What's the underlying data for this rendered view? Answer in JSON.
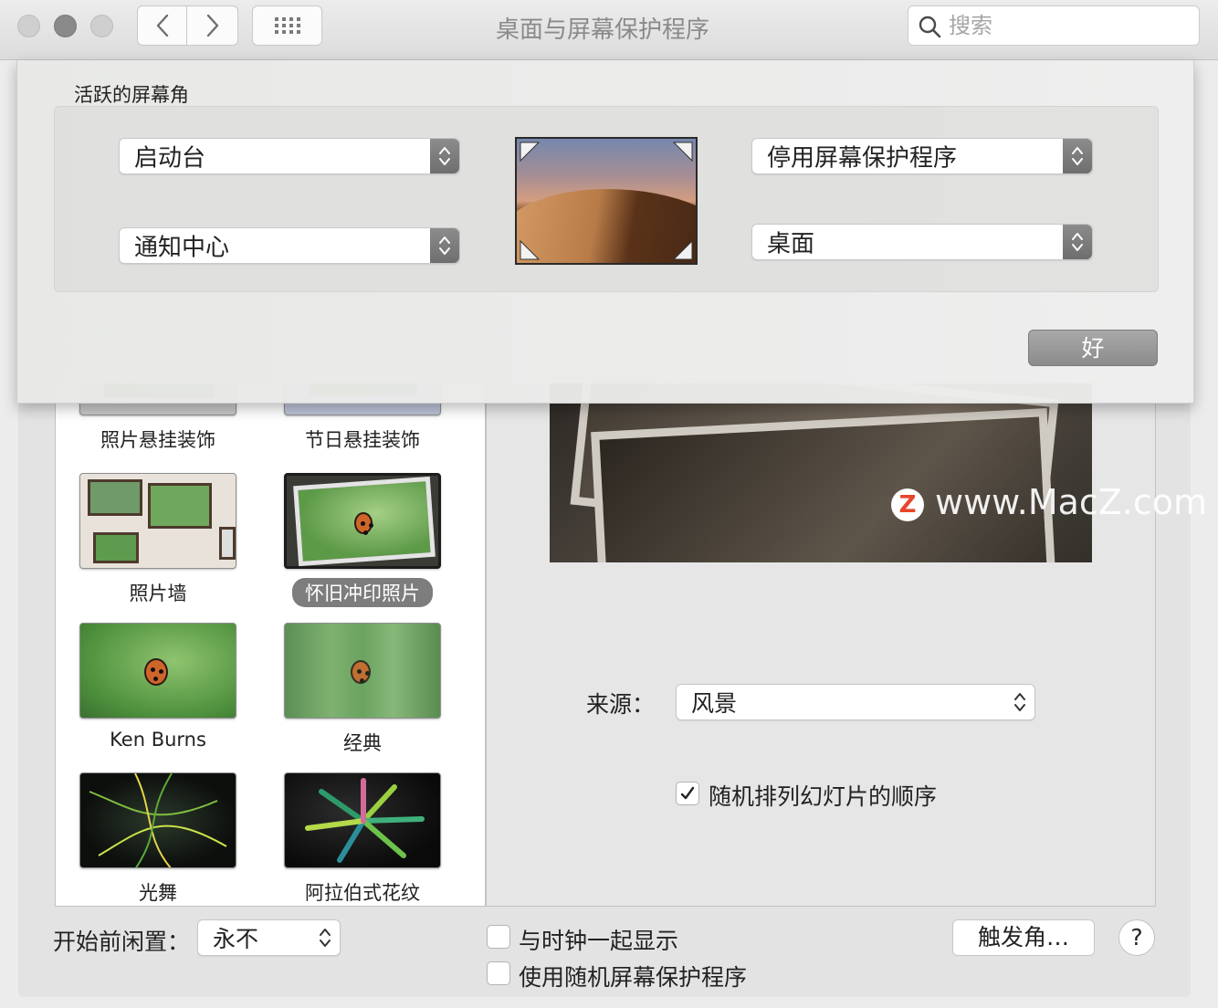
{
  "window": {
    "title": "桌面与屏幕保护程序"
  },
  "search": {
    "placeholder": "搜索"
  },
  "hot_corners_sheet": {
    "title": "活跃的屏幕角",
    "top_left": "启动台",
    "bottom_left": "通知中心",
    "top_right": "停用屏幕保护程序",
    "bottom_right": "桌面",
    "ok_label": "好"
  },
  "screensavers": [
    {
      "label": "照片悬挂装饰"
    },
    {
      "label": "节日悬挂装饰"
    },
    {
      "label": "照片墙"
    },
    {
      "label": "怀旧冲印照片",
      "selected": true
    },
    {
      "label": "Ken Burns"
    },
    {
      "label": "经典"
    },
    {
      "label": "光舞"
    },
    {
      "label": "阿拉伯式花纹"
    }
  ],
  "preview": {
    "watermark": "www.MacZ.com",
    "watermark_logo": "Z"
  },
  "source": {
    "label": "来源：",
    "value": "风景"
  },
  "shuffle": {
    "label": "随机排列幻灯片的顺序",
    "checked": true
  },
  "bottom": {
    "idle_label": "开始前闲置：",
    "idle_value": "永不",
    "show_clock_label": "与时钟一起显示",
    "show_clock_checked": false,
    "random_saver_label": "使用随机屏幕保护程序",
    "random_saver_checked": false,
    "hot_corners_button": "触发角…",
    "help_button": "?"
  },
  "icons": [
    "back-icon",
    "forward-icon",
    "grid-icon",
    "search-icon",
    "updown-chevron-icon",
    "checkmark-icon"
  ]
}
